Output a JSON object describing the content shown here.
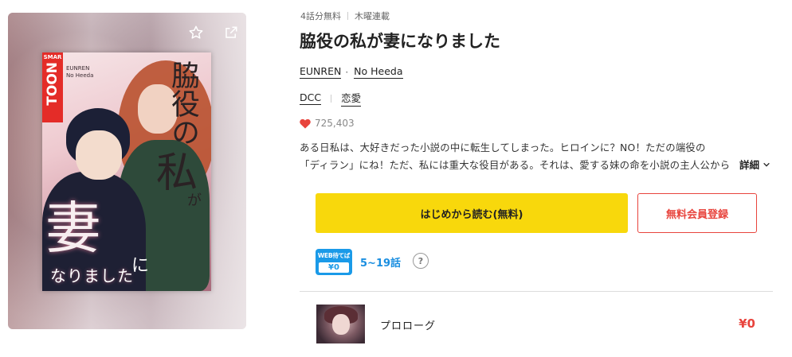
{
  "cover": {
    "badge_top": "SMAR",
    "badge_main": "TOON",
    "authors_line1": "EUNREN",
    "authors_line2": "No Heeda",
    "title_text": "脇役の",
    "big_char1": "私",
    "ga": "が",
    "big_char2": "妻",
    "ni": "に",
    "sub_text": "なりました"
  },
  "actions": {
    "favorite_icon": "star-outline-icon",
    "share_icon": "external-share-icon"
  },
  "meta": {
    "free_count": "4話分無料",
    "schedule": "木曜連載"
  },
  "title": "脇役の私が妻になりました",
  "authors": [
    "EUNREN",
    "No Heeda"
  ],
  "tags": [
    "DCC",
    "恋愛"
  ],
  "likes": "725,403",
  "description": {
    "line1": "ある日私は、大好きだった小説の中に転生してしまった。ヒロインに？NO！ただの端役の",
    "line2": "「ディラン」にね！ただ、私には重大な役目がある。それは、愛する妹の命を小説の主人公から",
    "more_label": "詳細"
  },
  "buttons": {
    "read_label": "はじめから読む(無料)",
    "register_label": "無料会員登録"
  },
  "wait_free": {
    "badge_top": "WEB待てば",
    "badge_price": "¥0",
    "range": "5~19話",
    "help": "?"
  },
  "episodes": [
    {
      "title": "プロローグ",
      "price": "¥0"
    }
  ],
  "colors": {
    "accent_yellow": "#f8d80c",
    "accent_red": "#e8443d",
    "wait_blue": "#1a9ae8"
  }
}
